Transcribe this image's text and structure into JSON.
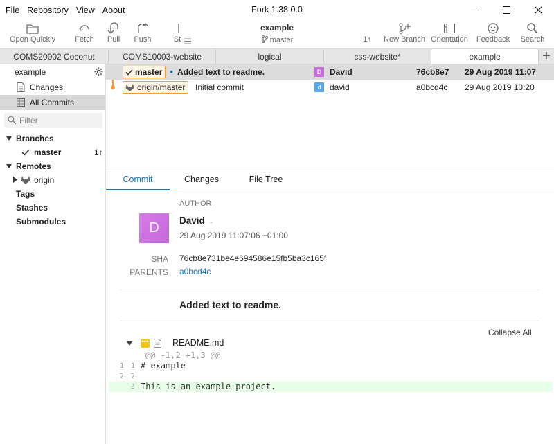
{
  "menu": [
    "File",
    "Repository",
    "View",
    "About"
  ],
  "window": {
    "title": "Fork 1.38.0.0"
  },
  "toolbar": {
    "open_quickly": "Open Quickly",
    "fetch": "Fetch",
    "pull": "Pull",
    "push": "Push",
    "stash": "St",
    "repo_name": "example",
    "current_branch": "master",
    "ahead": "1↑",
    "new_branch": "New Branch",
    "orientation": "Orientation",
    "feedback": "Feedback",
    "search": "Search"
  },
  "tabs": [
    "COMS20002 Coconut",
    "COMS10003-website",
    "logical",
    "css-website*",
    "example"
  ],
  "sidebar": {
    "repo": "example",
    "changes": "Changes",
    "all_commits": "All Commits",
    "filter_placeholder": "Filter",
    "branches": "Branches",
    "branch_master": "master",
    "branch_master_ahead": "1↑",
    "remotes": "Remotes",
    "remote_origin": "origin",
    "tags": "Tags",
    "stashes": "Stashes",
    "submodules": "Submodules"
  },
  "commits": [
    {
      "branch": "master",
      "message": "Added text to readme.",
      "author_initial": "D",
      "author": "David",
      "sha": "76cb8e7",
      "date": "29 Aug 2019 11:07"
    },
    {
      "branch": "origin/master",
      "message": "Initial commit",
      "author_initial": "d",
      "author": "david",
      "sha": "a0bcd4c",
      "date": "29 Aug 2019 10:20"
    }
  ],
  "detail_tabs": [
    "Commit",
    "Changes",
    "File Tree"
  ],
  "detail": {
    "author_label": "AUTHOR",
    "author_initial": "D",
    "author_name": "David",
    "author_dash": "-",
    "author_date": "29 Aug 2019 11:07:06 +01:00",
    "sha_label": "SHA",
    "sha": "76cb8e731be4e694586e15fb5ba3c165f",
    "parents_label": "PARENTS",
    "parent": "a0bcd4c",
    "message": "Added text to readme.",
    "collapse_all": "Collapse All",
    "file_name": "README.md",
    "hunk": "@@ -1,2 +1,3 @@",
    "lines": [
      {
        "old": "1",
        "new": "1",
        "text": "# example"
      },
      {
        "old": "2",
        "new": "2",
        "text": ""
      },
      {
        "old": "",
        "new": "3",
        "text": "This is an example project."
      }
    ]
  },
  "colors": {
    "accent": "#1a73b8",
    "branch_border": "#f29d2e",
    "avatar_david_upper": "#c86fde",
    "avatar_david_lower": "#5aa9e6",
    "added_line_bg": "#e6ffe6"
  }
}
